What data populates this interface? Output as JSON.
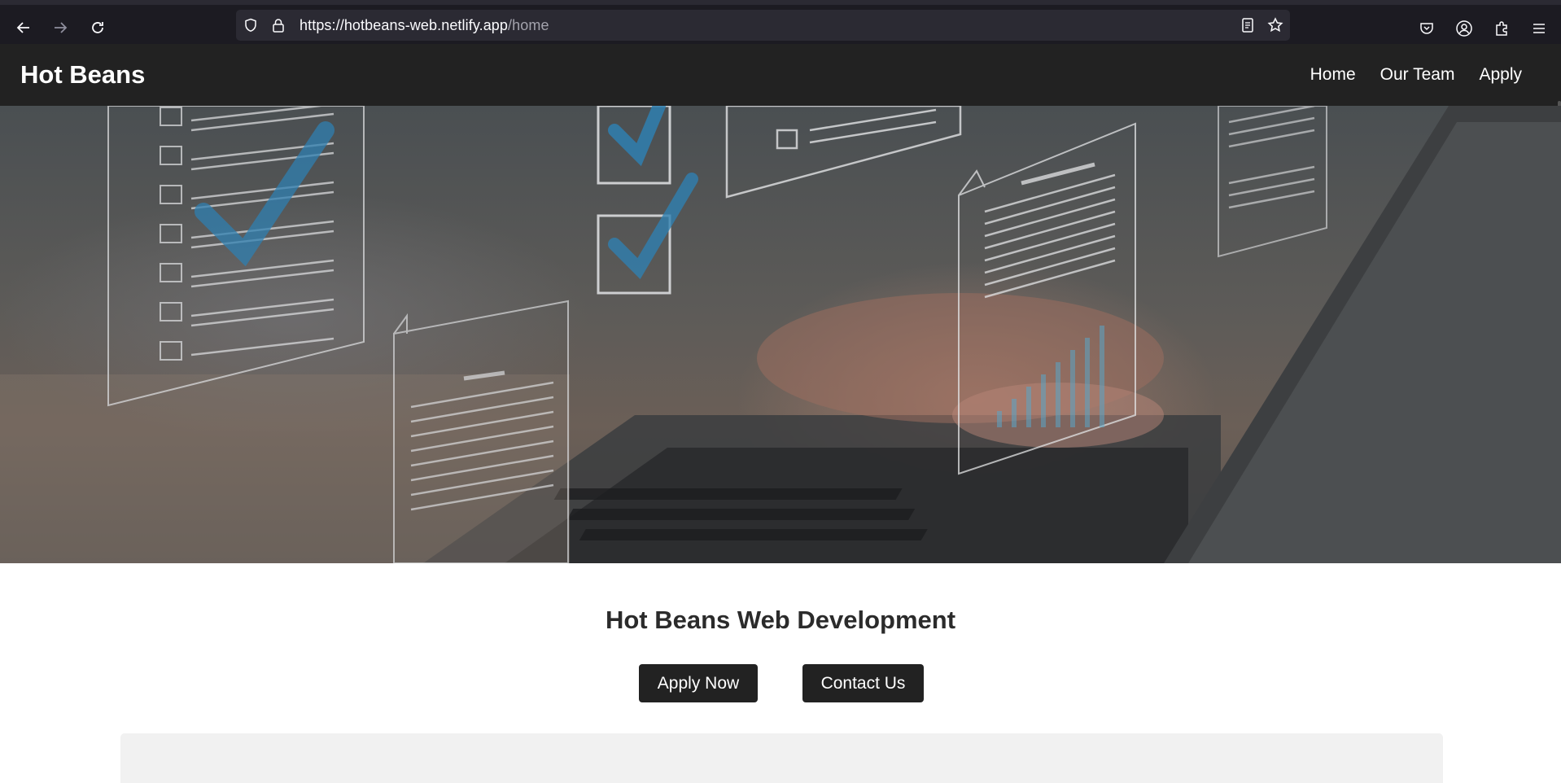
{
  "browser": {
    "url_host": "https://hotbeans-web.netlify.app",
    "url_path": "/home"
  },
  "site": {
    "logo": "Hot Beans",
    "nav": [
      {
        "label": "Home"
      },
      {
        "label": "Our Team"
      },
      {
        "label": "Apply"
      }
    ]
  },
  "hero": {
    "image_description_icon": "checklist-laptop-image"
  },
  "main": {
    "title": "Hot Beans Web Development",
    "apply_label": "Apply Now",
    "contact_label": "Contact Us"
  },
  "colors": {
    "header_bg": "#222222",
    "browser_bg": "#1c1b22",
    "urlbar_bg": "#2b2a33",
    "panel_bg": "#f1f1f1"
  }
}
